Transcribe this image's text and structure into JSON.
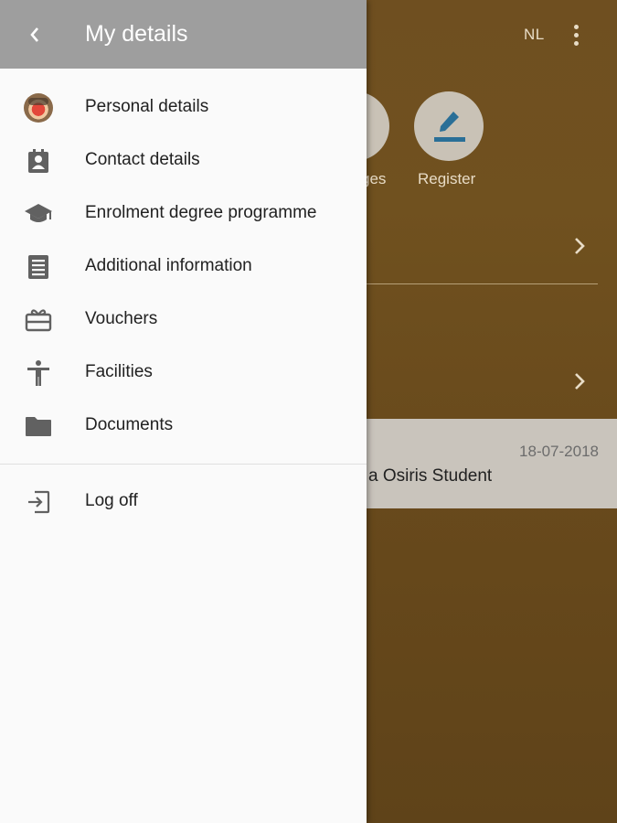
{
  "background": {
    "language_label": "NL",
    "shortcuts": [
      {
        "label": "ges"
      },
      {
        "label": "Register"
      }
    ],
    "card": {
      "date": "18-07-2018",
      "title": "a Osiris Student"
    }
  },
  "drawer": {
    "title": "My details",
    "items": [
      {
        "label": "Personal details",
        "icon": "avatar-icon"
      },
      {
        "label": "Contact details",
        "icon": "contact-card-icon"
      },
      {
        "label": "Enrolment degree programme",
        "icon": "graduation-cap-icon"
      },
      {
        "label": "Additional information",
        "icon": "document-lines-icon"
      },
      {
        "label": "Vouchers",
        "icon": "gift-card-icon"
      },
      {
        "label": "Facilities",
        "icon": "accessibility-icon"
      },
      {
        "label": "Documents",
        "icon": "folder-icon"
      }
    ],
    "logoff": {
      "label": "Log off",
      "icon": "exit-icon"
    }
  },
  "colors": {
    "header": "#9e9e9e",
    "drawer_bg": "#fafafa",
    "background_brown": "#6b4c1e",
    "icon_gray": "#616161",
    "accent_blue": "#2a6f97"
  }
}
